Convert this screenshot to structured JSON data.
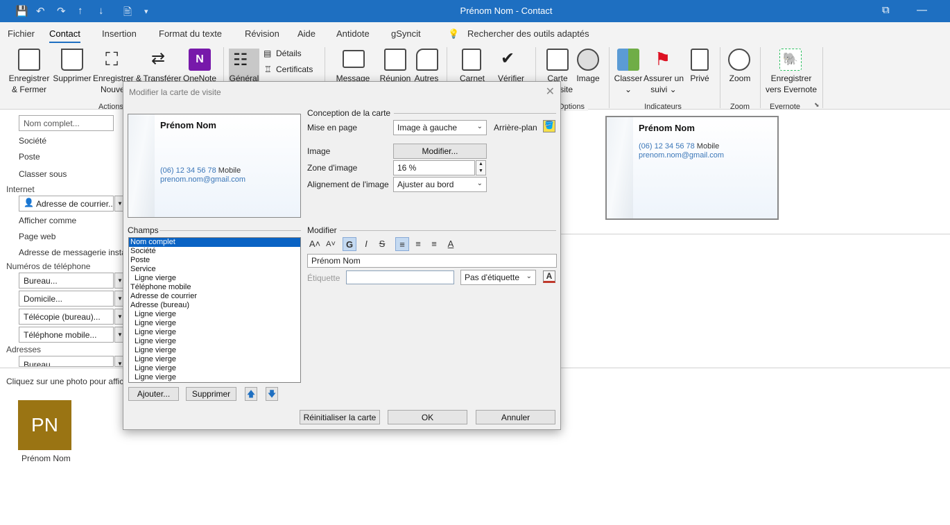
{
  "window": {
    "title": "Prénom Nom  -  Contact",
    "quick_access": [
      "💾",
      "↶",
      "↷",
      "↑",
      "↓",
      "🖹",
      "▾"
    ]
  },
  "menu": [
    "Fichier",
    "Contact",
    "Insertion",
    "Format du texte",
    "Révision",
    "Aide",
    "Antidote",
    "gSyncit",
    "Rechercher des outils adaptés"
  ],
  "ribbon": {
    "btn1": "Enregistrer\n& Fermer",
    "btn2": "Supprimer",
    "btn3": "Enregistrer &\nNouveau",
    "btn4": "Transférer",
    "btn5": "OneNote",
    "btn6": "Général",
    "btn7": "Détails",
    "btn8": "Certificats",
    "btn9": "Message",
    "btn10": "Réunion",
    "btn11": "Autres",
    "btn12": "Carnet",
    "btn13": "Vérifier",
    "btn14": "Carte\nde visite",
    "btn15": "Image",
    "btn16": "Classer\n⌄",
    "btn17": "Assurer un\nsuivi ⌄",
    "btn18": "Privé",
    "btn19": "Zoom",
    "btn20": "Enregistrer\nvers Evernote",
    "grp_actions": "Actions",
    "grp_options": "Options",
    "grp_indicateurs": "Indicateurs",
    "grp_zoom": "Zoom",
    "grp_evernote": "Evernote"
  },
  "form": {
    "nom_complet": "Nom complet...",
    "societe": "Société",
    "poste": "Poste",
    "classer_sous": "Classer sous",
    "internet": "Internet",
    "adresse_courrier": "Adresse de courrier...",
    "afficher_comme": "Afficher comme",
    "page_web": "Page web",
    "messagerie": "Adresse de messagerie instantanée",
    "numeros": "Numéros de téléphone",
    "bureau": "Bureau...",
    "domicile": "Domicile...",
    "telecopie": "Télécopie (bureau)...",
    "mobile": "Téléphone mobile...",
    "adresses": "Adresses",
    "adr_bureau": "Bureau...",
    "photo_hint": "Cliquez sur une photo pour afficher",
    "avatar": "PN",
    "avatar_name": "Prénom Nom"
  },
  "card": {
    "name": "Prénom Nom",
    "phone": "(06) 12 34 56 78",
    "phone_label": "Mobile",
    "email": "prenom.nom@gmail.com"
  },
  "dialog": {
    "title": "Modifier la carte de visite",
    "close": "✕",
    "conception": "Conception de la carte",
    "mise_en_page": "Mise en page",
    "mise_en_page_value": "Image à gauche",
    "arriere_plan": "Arrière-plan",
    "image": "Image",
    "modifier_btn": "Modifier...",
    "zone_image": "Zone d'image",
    "zone_value": "16 %",
    "alignement": "Alignement de l'image",
    "alignement_value": "Ajuster au bord",
    "champs": "Champs",
    "fields": [
      "Nom complet",
      "Société",
      "Poste",
      "Service",
      "Ligne vierge",
      "Téléphone mobile",
      "Adresse de courrier",
      "Adresse (bureau)",
      "Ligne vierge",
      "Ligne vierge",
      "Ligne vierge",
      "Ligne vierge",
      "Ligne vierge",
      "Ligne vierge",
      "Ligne vierge",
      "Ligne vierge"
    ],
    "modifier": "Modifier",
    "text_value": "Prénom Nom",
    "etiquette": "Étiquette",
    "etiquette_select": "Pas d'étiquette",
    "ajouter": "Ajouter...",
    "supprimer": "Supprimer",
    "reinit": "Réinitialiser la carte",
    "ok": "OK",
    "annuler": "Annuler",
    "fmt": {
      "grow": "A˄",
      "shrink": "A˅",
      "bold": "G",
      "italic": "I",
      "strike": "S",
      "align_left": "≡",
      "align_center": "≡",
      "align_right": "≡",
      "color": "A"
    }
  },
  "colors": {
    "accent": "#1e6fc1",
    "selection": "#0a63c4",
    "avatar": "#9a7413"
  }
}
